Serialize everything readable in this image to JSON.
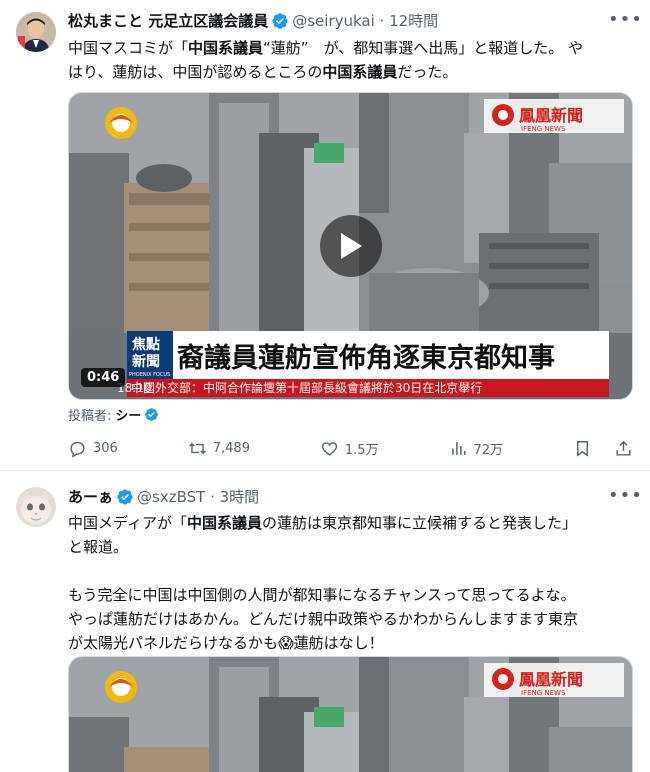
{
  "tweets": [
    {
      "author_name": "松丸まこと 元足立区議会議員",
      "handle": "@seiryukai",
      "time": "12時間",
      "text_lines": [
        {
          "pre": "中国マスコミが「",
          "bold": "中国系議員",
          "post": "“蓮舫”　が、都知事選へ出馬」と報道した。 や"
        },
        {
          "pre": "はり、蓮舫は、中国が認めるところの",
          "bold": "中国系議員",
          "post": "だった。"
        }
      ],
      "video": {
        "duration": "0:46",
        "caption_main": "裔議員蓮舫宣佈角逐東京都知事",
        "caption_sub": "中國外交部：中阿合作論壇第十屆部長級會議將於30日在北京舉行",
        "logo_text": "鳳凰新聞",
        "logo_sub": "IFENG NEWS",
        "badge_top": "焦點",
        "badge_bottom": "新聞",
        "badge_en": "PHOENIX FOCUS",
        "clock": "18:10"
      },
      "posted_by_label": "投稿者:",
      "posted_by_name": "シー",
      "stats": {
        "replies": "306",
        "retweets": "7,489",
        "likes": "1.5万",
        "views": "72万"
      }
    },
    {
      "author_name": "あーぁ",
      "handle": "@sxzBST",
      "time": "3時間",
      "text_lines": [
        {
          "pre": "中国メディアが「",
          "bold": "中国系議員",
          "post": "の蓮舫は東京都知事に立候補すると発表した」"
        },
        {
          "pre": "と報道。",
          "bold": "",
          "post": ""
        },
        {
          "pre": "",
          "bold": "",
          "post": ""
        },
        {
          "pre": "もう完全に中国は中国側の人間が都知事になるチャンスって思ってるよな。",
          "bold": "",
          "post": ""
        },
        {
          "pre": "やっぱ蓮舫だけはあかん。どんだけ親中政策やるかわからんしますます東京",
          "bold": "",
          "post": ""
        },
        {
          "pre": "が太陽光パネルだらけなるかも😱蓮舫はなし！",
          "bold": "",
          "post": ""
        }
      ],
      "video": {
        "logo_text": "鳳凰新聞",
        "logo_sub": "IFENG NEWS"
      }
    }
  ],
  "icons": [
    "verified-badge-icon",
    "more-icon",
    "reply-icon",
    "retweet-icon",
    "like-icon",
    "views-icon",
    "bookmark-icon",
    "share-icon",
    "play-icon"
  ],
  "colors": {
    "verified": "#1d9bf0",
    "secondary_text": "#536471",
    "caption_red": "#c8171e"
  }
}
